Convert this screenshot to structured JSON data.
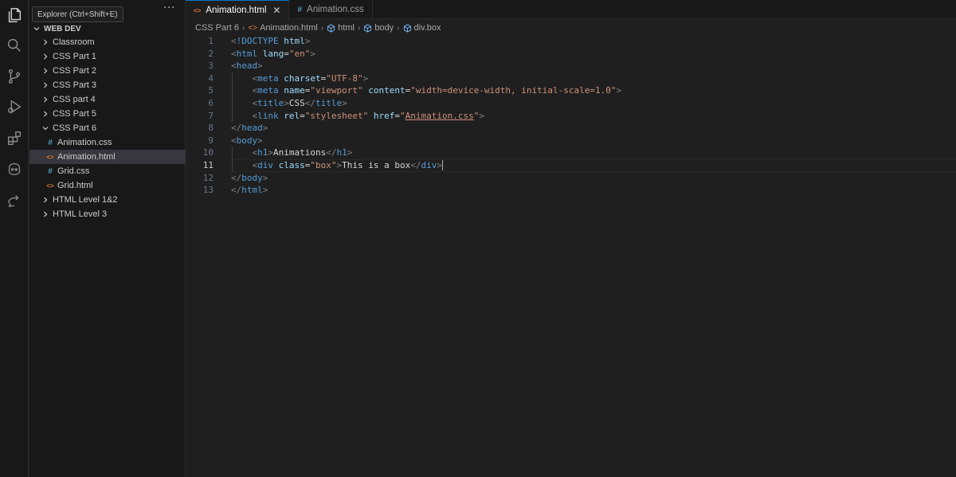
{
  "tooltip": "Explorer (Ctrl+Shift+E)",
  "activity_bar": [
    {
      "name": "explorer-icon",
      "active": true
    },
    {
      "name": "search-icon",
      "active": false
    },
    {
      "name": "source-control-icon",
      "active": false
    },
    {
      "name": "run-debug-icon",
      "active": false
    },
    {
      "name": "extensions-icon",
      "active": false
    },
    {
      "name": "copilot-icon",
      "active": false
    },
    {
      "name": "remote-explorer-icon",
      "active": false
    }
  ],
  "sidebar": {
    "more": "···",
    "workspace": "WEB DEV",
    "items": [
      {
        "label": "Classroom",
        "type": "folder",
        "expanded": false,
        "depth": 1
      },
      {
        "label": "CSS Part 1",
        "type": "folder",
        "expanded": false,
        "depth": 1
      },
      {
        "label": "CSS Part 2",
        "type": "folder",
        "expanded": false,
        "depth": 1
      },
      {
        "label": "CSS Part 3",
        "type": "folder",
        "expanded": false,
        "depth": 1
      },
      {
        "label": "CSS part 4",
        "type": "folder",
        "expanded": false,
        "depth": 1
      },
      {
        "label": "CSS Part 5",
        "type": "folder",
        "expanded": false,
        "depth": 1
      },
      {
        "label": "CSS Part 6",
        "type": "folder",
        "expanded": true,
        "depth": 1
      },
      {
        "label": "Animation.css",
        "type": "css",
        "depth": 2
      },
      {
        "label": "Animation.html",
        "type": "html",
        "depth": 2,
        "selected": true
      },
      {
        "label": "Grid.css",
        "type": "css",
        "depth": 2
      },
      {
        "label": "Grid.html",
        "type": "html",
        "depth": 2
      },
      {
        "label": "HTML Level 1&2",
        "type": "folder",
        "expanded": false,
        "depth": 1
      },
      {
        "label": "HTML Level 3",
        "type": "folder",
        "expanded": false,
        "depth": 1
      }
    ]
  },
  "tabs": [
    {
      "label": "Animation.html",
      "type": "html",
      "active": true,
      "close": "✕"
    },
    {
      "label": "Animation.css",
      "type": "css",
      "active": false
    }
  ],
  "breadcrumb": [
    "CSS Part 6",
    "Animation.html",
    "html",
    "body",
    "div.box"
  ],
  "editor": {
    "current_line": 11,
    "lines": [
      [
        [
          "bracket",
          "<"
        ],
        [
          "tag",
          "!DOCTYPE "
        ],
        [
          "attr",
          "html"
        ],
        [
          "bracket",
          ">"
        ]
      ],
      [
        [
          "bracket",
          "<"
        ],
        [
          "tag",
          "html "
        ],
        [
          "attr",
          "lang"
        ],
        [
          "text",
          "="
        ],
        [
          "str",
          "\"en\""
        ],
        [
          "bracket",
          ">"
        ]
      ],
      [
        [
          "bracket",
          "<"
        ],
        [
          "tag",
          "head"
        ],
        [
          "bracket",
          ">"
        ]
      ],
      [
        [
          "text",
          "    "
        ],
        [
          "bracket",
          "<"
        ],
        [
          "tag",
          "meta "
        ],
        [
          "attr",
          "charset"
        ],
        [
          "text",
          "="
        ],
        [
          "str",
          "\"UTF-8\""
        ],
        [
          "bracket",
          ">"
        ]
      ],
      [
        [
          "text",
          "    "
        ],
        [
          "bracket",
          "<"
        ],
        [
          "tag",
          "meta "
        ],
        [
          "attr",
          "name"
        ],
        [
          "text",
          "="
        ],
        [
          "str",
          "\"viewport\""
        ],
        [
          "text",
          " "
        ],
        [
          "attr",
          "content"
        ],
        [
          "text",
          "="
        ],
        [
          "str",
          "\"width=device-width, initial-scale=1.0\""
        ],
        [
          "bracket",
          ">"
        ]
      ],
      [
        [
          "text",
          "    "
        ],
        [
          "bracket",
          "<"
        ],
        [
          "tag",
          "title"
        ],
        [
          "bracket",
          ">"
        ],
        [
          "text",
          "CSS"
        ],
        [
          "bracket",
          "</"
        ],
        [
          "tag",
          "title"
        ],
        [
          "bracket",
          ">"
        ]
      ],
      [
        [
          "text",
          "    "
        ],
        [
          "bracket",
          "<"
        ],
        [
          "tag",
          "link "
        ],
        [
          "attr",
          "rel"
        ],
        [
          "text",
          "="
        ],
        [
          "str",
          "\"stylesheet\""
        ],
        [
          "text",
          " "
        ],
        [
          "attr",
          "href"
        ],
        [
          "text",
          "="
        ],
        [
          "str",
          "\""
        ],
        [
          "link",
          "Animation.css"
        ],
        [
          "str",
          "\""
        ],
        [
          "bracket",
          ">"
        ]
      ],
      [
        [
          "bracket",
          "</"
        ],
        [
          "tag",
          "head"
        ],
        [
          "bracket",
          ">"
        ]
      ],
      [
        [
          "bracket",
          "<"
        ],
        [
          "tag",
          "body"
        ],
        [
          "bracket",
          ">"
        ]
      ],
      [
        [
          "text",
          "    "
        ],
        [
          "bracket",
          "<"
        ],
        [
          "tag",
          "h1"
        ],
        [
          "bracket",
          ">"
        ],
        [
          "text",
          "Animations"
        ],
        [
          "bracket",
          "</"
        ],
        [
          "tag",
          "h1"
        ],
        [
          "bracket",
          ">"
        ]
      ],
      [
        [
          "text",
          "    "
        ],
        [
          "bracket",
          "<"
        ],
        [
          "tag",
          "div "
        ],
        [
          "attr",
          "class"
        ],
        [
          "text",
          "="
        ],
        [
          "str",
          "\"box\""
        ],
        [
          "bracket",
          ">"
        ],
        [
          "text",
          "This is a box"
        ],
        [
          "bracket",
          "</"
        ],
        [
          "tag",
          "div"
        ],
        [
          "bracket",
          ">"
        ],
        [
          "cursor",
          ""
        ]
      ],
      [
        [
          "bracket",
          "</"
        ],
        [
          "tag",
          "body"
        ],
        [
          "bracket",
          ">"
        ]
      ],
      [
        [
          "bracket",
          "</"
        ],
        [
          "tag",
          "html"
        ],
        [
          "bracket",
          ">"
        ]
      ]
    ]
  }
}
